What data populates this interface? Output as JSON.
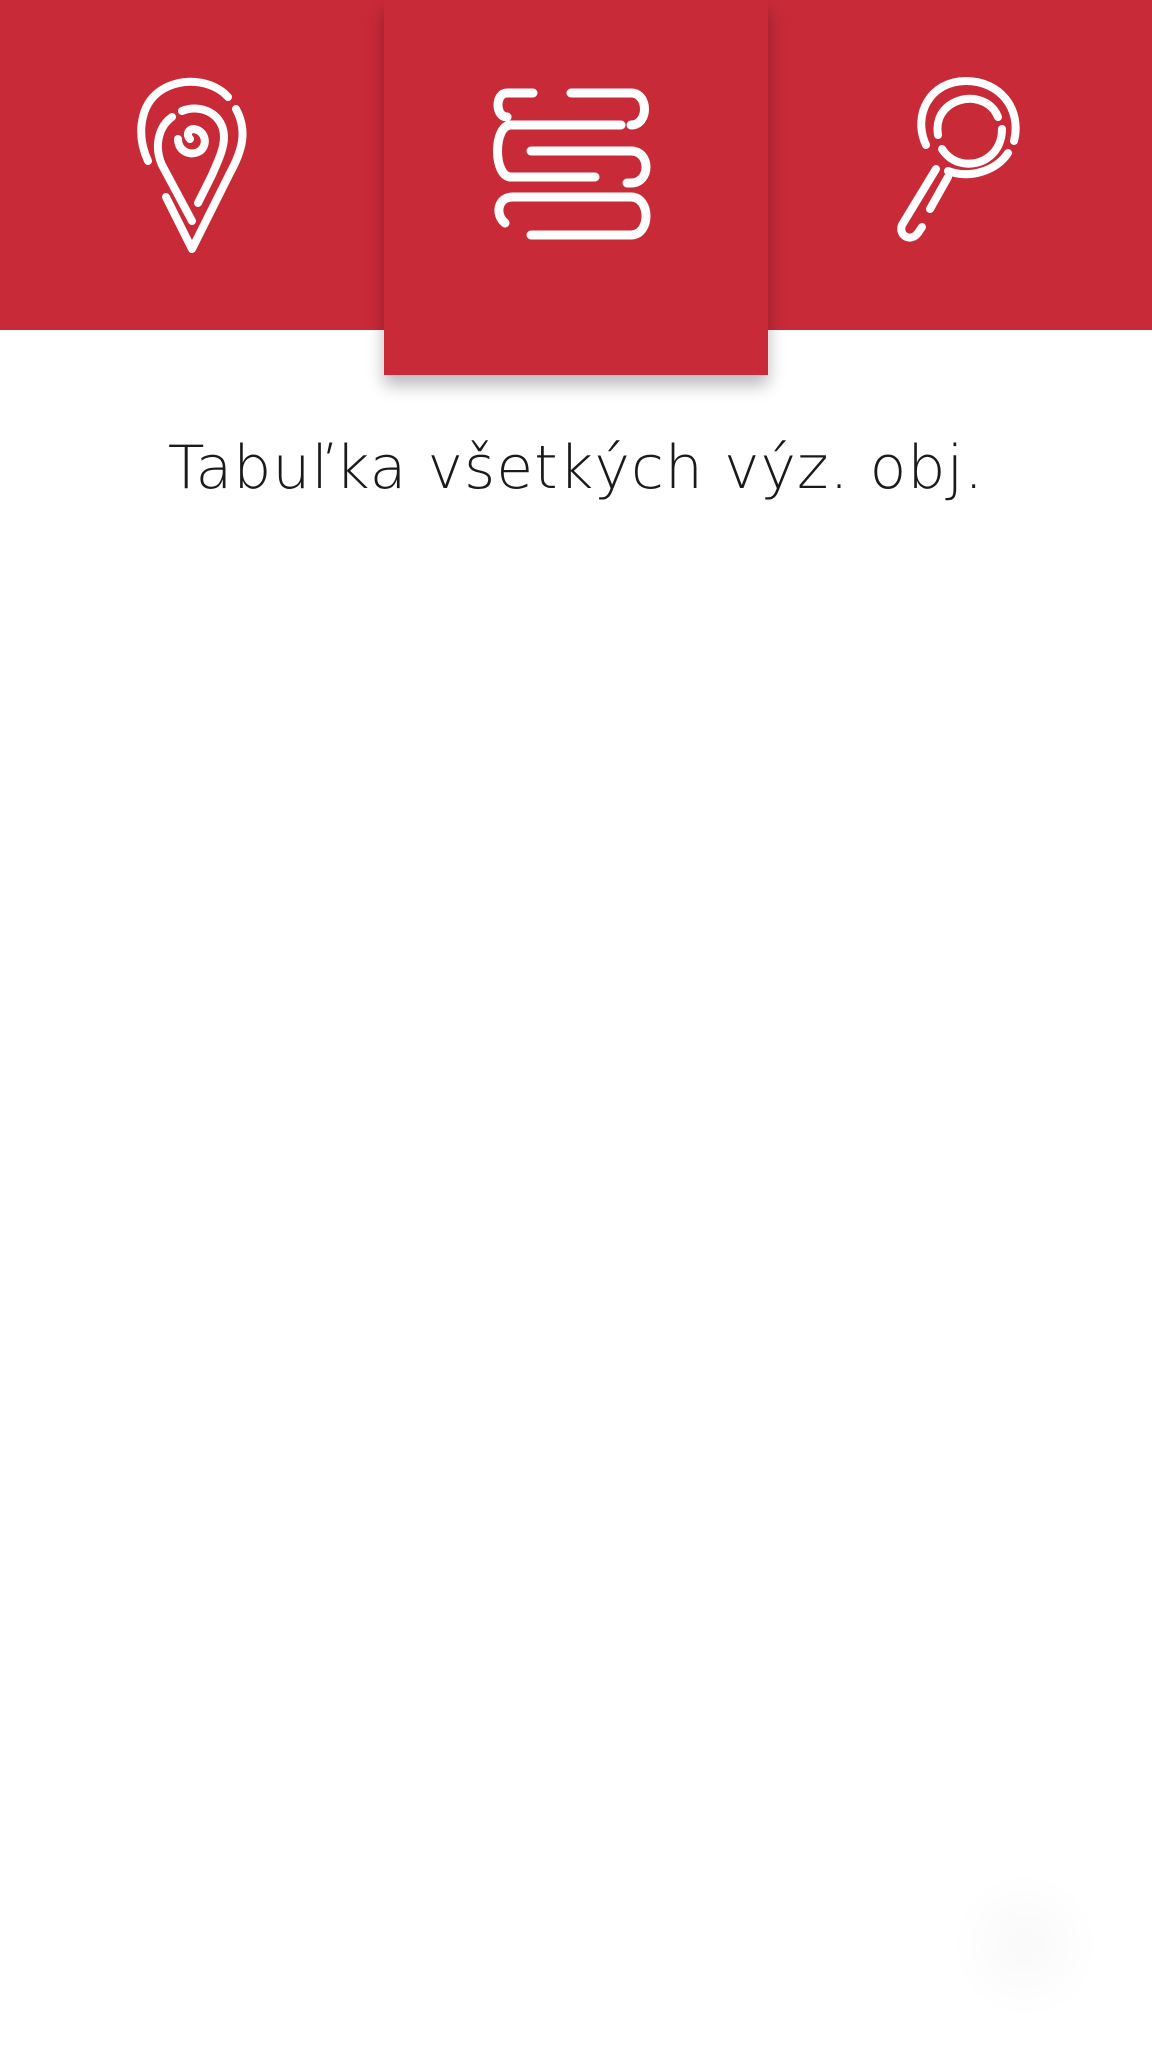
{
  "header": {
    "background_color": "#c92a38",
    "icon_color": "#ffffff",
    "tabs": [
      {
        "icon": "location-pin-icon",
        "active": false
      },
      {
        "icon": "list-stack-icon",
        "active": true
      },
      {
        "icon": "magnifier-search-icon",
        "active": false
      }
    ]
  },
  "main": {
    "title": "Tabuľka všetkých výz. obj."
  }
}
